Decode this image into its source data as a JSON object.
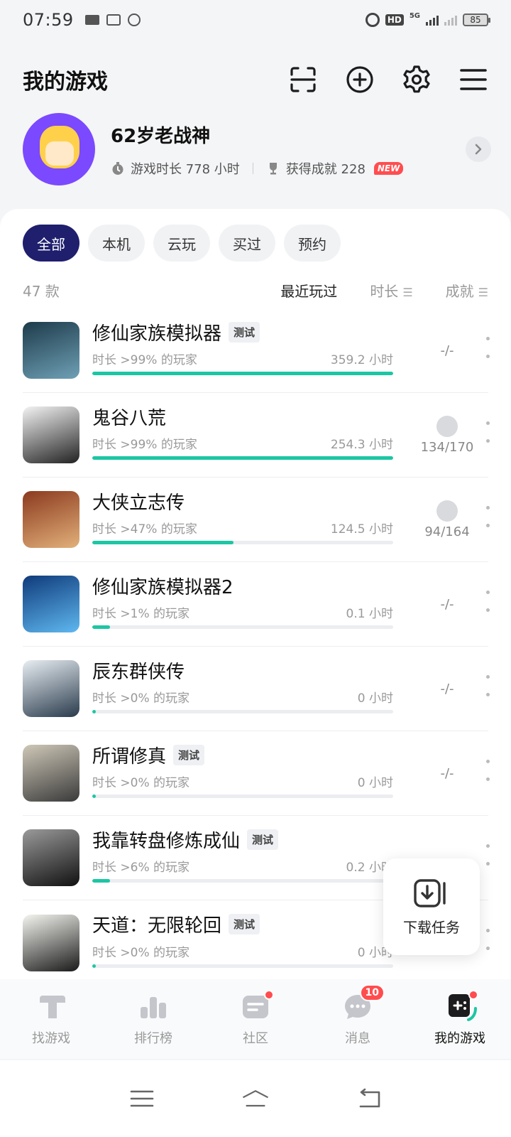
{
  "status_bar": {
    "time": "07:59",
    "battery": "85"
  },
  "header": {
    "title": "我的游戏",
    "actions": [
      "scan-icon",
      "add-icon",
      "settings-icon",
      "menu-icon"
    ]
  },
  "profile": {
    "username": "62岁老战神",
    "play_time_label": "游戏时长 778 小时",
    "achievements_label": "获得成就 228",
    "new_badge": "NEW"
  },
  "filters": [
    "全部",
    "本机",
    "云玩",
    "买过",
    "预约"
  ],
  "active_filter": 0,
  "list_header": {
    "count": "47 款",
    "sort_recent": "最近玩过",
    "sort_time": "时长",
    "sort_achievement": "成就"
  },
  "games": [
    {
      "title": "修仙家族模拟器",
      "tag": "测试",
      "percentile": "时长 >99% 的玩家",
      "hours": "359.2 小时",
      "progress": 1.0,
      "achievement": "-/-",
      "has_trophy": false,
      "icon_colors": [
        "#1d3b4a",
        "#6fa0b6"
      ]
    },
    {
      "title": "鬼谷八荒",
      "tag": "",
      "percentile": "时长 >99% 的玩家",
      "hours": "254.3 小时",
      "progress": 1.0,
      "achievement": "134/170",
      "has_trophy": true,
      "icon_colors": [
        "#f3f3f3",
        "#222222"
      ]
    },
    {
      "title": "大侠立志传",
      "tag": "",
      "percentile": "时长 >47% 的玩家",
      "hours": "124.5 小时",
      "progress": 0.47,
      "achievement": "94/164",
      "has_trophy": true,
      "icon_colors": [
        "#8b3a1e",
        "#e2b07a"
      ]
    },
    {
      "title": "修仙家族模拟器2",
      "tag": "",
      "percentile": "时长 >1% 的玩家",
      "hours": "0.1 小时",
      "progress": 0.01,
      "achievement": "-/-",
      "has_trophy": false,
      "icon_colors": [
        "#0f3a7a",
        "#5fb8f0"
      ]
    },
    {
      "title": "辰东群侠传",
      "tag": "",
      "percentile": "时长 >0% 的玩家",
      "hours": "0 小时",
      "progress": 0.0,
      "achievement": "-/-",
      "has_trophy": false,
      "icon_colors": [
        "#e8eef3",
        "#2a3b4c"
      ]
    },
    {
      "title": "所谓修真",
      "tag": "测试",
      "percentile": "时长 >0% 的玩家",
      "hours": "0 小时",
      "progress": 0.0,
      "achievement": "-/-",
      "has_trophy": false,
      "icon_colors": [
        "#cfc8b8",
        "#3a3a3a"
      ]
    },
    {
      "title": "我靠转盘修炼成仙",
      "tag": "测试",
      "percentile": "时长 >6% 的玩家",
      "hours": "0.2 小时",
      "progress": 0.06,
      "achievement": "",
      "has_trophy": false,
      "icon_colors": [
        "#9a9a9a",
        "#111111"
      ]
    },
    {
      "title": "天道：无限轮回",
      "tag": "测试",
      "percentile": "时长 >0% 的玩家",
      "hours": "0 小时",
      "progress": 0.0,
      "achievement": "",
      "has_trophy": false,
      "icon_colors": [
        "#f5f5f0",
        "#1a1a1a"
      ]
    }
  ],
  "download_fab": {
    "label": "下载任务"
  },
  "bottom_nav": [
    {
      "label": "找游戏",
      "dot": false,
      "badge": ""
    },
    {
      "label": "排行榜",
      "dot": false,
      "badge": ""
    },
    {
      "label": "社区",
      "dot": true,
      "badge": ""
    },
    {
      "label": "消息",
      "dot": false,
      "badge": "10"
    },
    {
      "label": "我的游戏",
      "dot": true,
      "badge": ""
    }
  ],
  "active_nav": 4,
  "colors": {
    "accent": "#1dc6a4",
    "chip_active": "#1f1f6e",
    "badge": "#ff4d4f"
  }
}
